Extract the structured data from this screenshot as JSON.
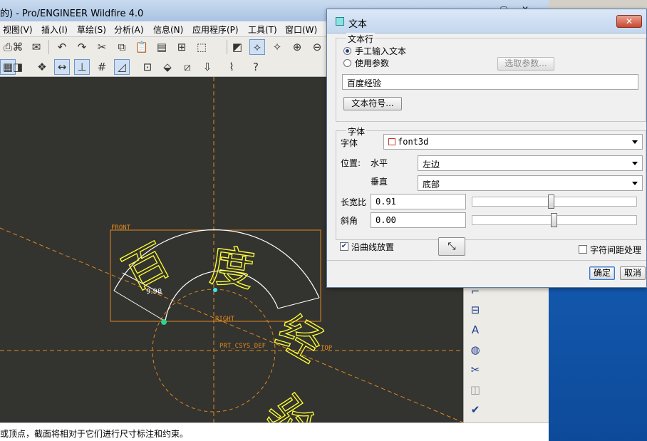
{
  "window": {
    "title": "的) - Pro/ENGINEER Wildfire 4.0"
  },
  "menubar": {
    "items": [
      "视图(V)",
      "插入(I)",
      "草绘(S)",
      "分析(A)",
      "信息(N)",
      "应用程序(P)",
      "工具(T)",
      "窗口(W)"
    ]
  },
  "canvas": {
    "sketch_text": [
      "百",
      "度",
      "经",
      "验"
    ],
    "label_front": "FRONT",
    "label_right": "RIGHT",
    "label_top": "TOP",
    "label_csys": "PRT_CSYS_DEF",
    "dimension": "9.98",
    "colors": {
      "background": "#333330",
      "text": "#ffff33",
      "datum": "#e08a1e",
      "arc": "#ffffff"
    }
  },
  "status": {
    "message": "或顶点，截面将相对于它们进行尺寸标注和约束。"
  },
  "dialog": {
    "title": "文本",
    "close_label": "✕",
    "textline": {
      "group_label": "文本行",
      "radio_manual": "手工输入文本",
      "radio_param": "使用参数",
      "select_param_button": "选取参数...",
      "text_value": "百度经验",
      "symbol_button": "文本符号..."
    },
    "font": {
      "group_label": "字体",
      "font_label": "字体",
      "font_value": "font3d",
      "position_label": "位置:",
      "horizontal_label": "水平",
      "horizontal_value": "左边",
      "vertical_label": "垂直",
      "vertical_value": "底部",
      "aspect_label": "长宽比",
      "aspect_value": "0.91",
      "slant_label": "斜角",
      "slant_value": "0.00"
    },
    "along_curve_label": "沿曲线放置",
    "along_curve_checked": true,
    "char_spacing_label": "字符间距处理",
    "char_spacing_checked": false,
    "ok_label": "确定",
    "cancel_label": "取消"
  }
}
